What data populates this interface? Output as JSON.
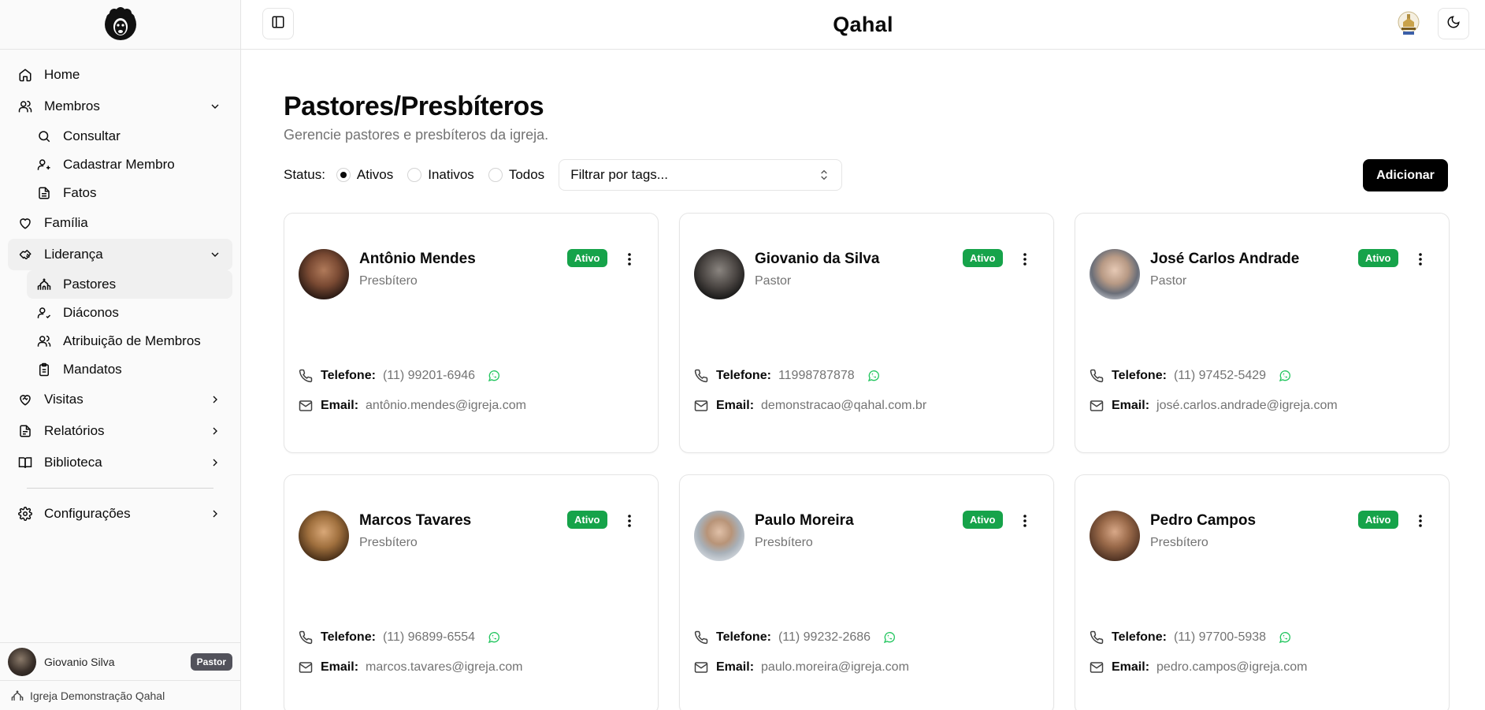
{
  "app": {
    "title": "Qahal"
  },
  "sidebar": {
    "items": [
      {
        "label": "Home",
        "icon": "home-icon"
      },
      {
        "label": "Membros",
        "icon": "users-icon",
        "expanded": true,
        "children": [
          {
            "label": "Consultar",
            "icon": "search-icon"
          },
          {
            "label": "Cadastrar Membro",
            "icon": "user-plus-icon"
          },
          {
            "label": "Fatos",
            "icon": "file-text-icon"
          }
        ]
      },
      {
        "label": "Família",
        "icon": "heart-icon"
      },
      {
        "label": "Liderança",
        "icon": "handshake-icon",
        "expanded": true,
        "children": [
          {
            "label": "Pastores",
            "icon": "church-icon",
            "active": true
          },
          {
            "label": "Diáconos",
            "icon": "user-check-icon"
          },
          {
            "label": "Atribuição de Membros",
            "icon": "users-icon"
          },
          {
            "label": "Mandatos",
            "icon": "clipboard-icon"
          }
        ]
      },
      {
        "label": "Visitas",
        "icon": "heart-handshake-icon"
      },
      {
        "label": "Relatórios",
        "icon": "file-report-icon"
      },
      {
        "label": "Biblioteca",
        "icon": "book-open-icon"
      },
      {
        "label": "Configurações",
        "icon": "gear-icon"
      }
    ],
    "user": {
      "name": "Giovanio Silva",
      "role": "Pastor"
    },
    "church": "Igreja Demonstração Qahal"
  },
  "page": {
    "title": "Pastores/Presbíteros",
    "subtitle": "Gerencie pastores e presbíteros da igreja.",
    "status_label": "Status:",
    "status_options": [
      "Ativos",
      "Inativos",
      "Todos"
    ],
    "status_selected": "Ativos",
    "tags_placeholder": "Filtrar por tags...",
    "add_label": "Adicionar"
  },
  "labels": {
    "phone": "Telefone:",
    "email": "Email:"
  },
  "people": [
    {
      "name": "Antônio Mendes",
      "role": "Presbítero",
      "status": "Ativo",
      "phone": "(11) 99201-6946",
      "email": "antônio.mendes@igreja.com"
    },
    {
      "name": "Giovanio da Silva",
      "role": "Pastor",
      "status": "Ativo",
      "phone": "11998787878",
      "email": "demonstracao@qahal.com.br"
    },
    {
      "name": "José Carlos Andrade",
      "role": "Pastor",
      "status": "Ativo",
      "phone": "(11) 97452-5429",
      "email": "josé.carlos.andrade@igreja.com"
    },
    {
      "name": "Marcos Tavares",
      "role": "Presbítero",
      "status": "Ativo",
      "phone": "(11) 96899-6554",
      "email": "marcos.tavares@igreja.com"
    },
    {
      "name": "Paulo Moreira",
      "role": "Presbítero",
      "status": "Ativo",
      "phone": "(11) 99232-2686",
      "email": "paulo.moreira@igreja.com"
    },
    {
      "name": "Pedro Campos",
      "role": "Presbítero",
      "status": "Ativo",
      "phone": "(11) 97700-5938",
      "email": "pedro.campos@igreja.com"
    }
  ],
  "colors": {
    "accent": "#000000",
    "status_active": "#16a34a",
    "whatsapp": "#22c55e",
    "muted_text": "#737373"
  }
}
